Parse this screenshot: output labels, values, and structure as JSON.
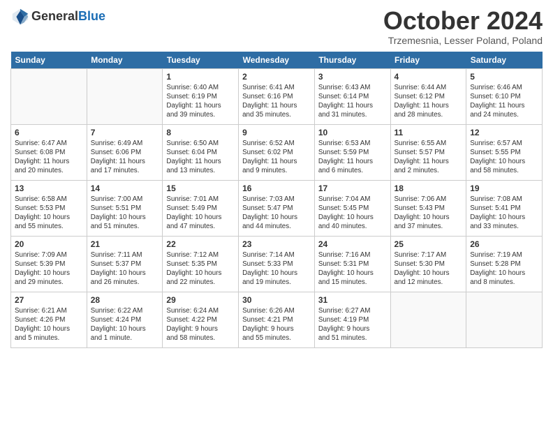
{
  "header": {
    "logo_general": "General",
    "logo_blue": "Blue",
    "month_title": "October 2024",
    "location": "Trzemesnia, Lesser Poland, Poland"
  },
  "weekdays": [
    "Sunday",
    "Monday",
    "Tuesday",
    "Wednesday",
    "Thursday",
    "Friday",
    "Saturday"
  ],
  "weeks": [
    [
      {
        "day": "",
        "detail": ""
      },
      {
        "day": "",
        "detail": ""
      },
      {
        "day": "1",
        "detail": "Sunrise: 6:40 AM\nSunset: 6:19 PM\nDaylight: 11 hours\nand 39 minutes."
      },
      {
        "day": "2",
        "detail": "Sunrise: 6:41 AM\nSunset: 6:16 PM\nDaylight: 11 hours\nand 35 minutes."
      },
      {
        "day": "3",
        "detail": "Sunrise: 6:43 AM\nSunset: 6:14 PM\nDaylight: 11 hours\nand 31 minutes."
      },
      {
        "day": "4",
        "detail": "Sunrise: 6:44 AM\nSunset: 6:12 PM\nDaylight: 11 hours\nand 28 minutes."
      },
      {
        "day": "5",
        "detail": "Sunrise: 6:46 AM\nSunset: 6:10 PM\nDaylight: 11 hours\nand 24 minutes."
      }
    ],
    [
      {
        "day": "6",
        "detail": "Sunrise: 6:47 AM\nSunset: 6:08 PM\nDaylight: 11 hours\nand 20 minutes."
      },
      {
        "day": "7",
        "detail": "Sunrise: 6:49 AM\nSunset: 6:06 PM\nDaylight: 11 hours\nand 17 minutes."
      },
      {
        "day": "8",
        "detail": "Sunrise: 6:50 AM\nSunset: 6:04 PM\nDaylight: 11 hours\nand 13 minutes."
      },
      {
        "day": "9",
        "detail": "Sunrise: 6:52 AM\nSunset: 6:02 PM\nDaylight: 11 hours\nand 9 minutes."
      },
      {
        "day": "10",
        "detail": "Sunrise: 6:53 AM\nSunset: 5:59 PM\nDaylight: 11 hours\nand 6 minutes."
      },
      {
        "day": "11",
        "detail": "Sunrise: 6:55 AM\nSunset: 5:57 PM\nDaylight: 11 hours\nand 2 minutes."
      },
      {
        "day": "12",
        "detail": "Sunrise: 6:57 AM\nSunset: 5:55 PM\nDaylight: 10 hours\nand 58 minutes."
      }
    ],
    [
      {
        "day": "13",
        "detail": "Sunrise: 6:58 AM\nSunset: 5:53 PM\nDaylight: 10 hours\nand 55 minutes."
      },
      {
        "day": "14",
        "detail": "Sunrise: 7:00 AM\nSunset: 5:51 PM\nDaylight: 10 hours\nand 51 minutes."
      },
      {
        "day": "15",
        "detail": "Sunrise: 7:01 AM\nSunset: 5:49 PM\nDaylight: 10 hours\nand 47 minutes."
      },
      {
        "day": "16",
        "detail": "Sunrise: 7:03 AM\nSunset: 5:47 PM\nDaylight: 10 hours\nand 44 minutes."
      },
      {
        "day": "17",
        "detail": "Sunrise: 7:04 AM\nSunset: 5:45 PM\nDaylight: 10 hours\nand 40 minutes."
      },
      {
        "day": "18",
        "detail": "Sunrise: 7:06 AM\nSunset: 5:43 PM\nDaylight: 10 hours\nand 37 minutes."
      },
      {
        "day": "19",
        "detail": "Sunrise: 7:08 AM\nSunset: 5:41 PM\nDaylight: 10 hours\nand 33 minutes."
      }
    ],
    [
      {
        "day": "20",
        "detail": "Sunrise: 7:09 AM\nSunset: 5:39 PM\nDaylight: 10 hours\nand 29 minutes."
      },
      {
        "day": "21",
        "detail": "Sunrise: 7:11 AM\nSunset: 5:37 PM\nDaylight: 10 hours\nand 26 minutes."
      },
      {
        "day": "22",
        "detail": "Sunrise: 7:12 AM\nSunset: 5:35 PM\nDaylight: 10 hours\nand 22 minutes."
      },
      {
        "day": "23",
        "detail": "Sunrise: 7:14 AM\nSunset: 5:33 PM\nDaylight: 10 hours\nand 19 minutes."
      },
      {
        "day": "24",
        "detail": "Sunrise: 7:16 AM\nSunset: 5:31 PM\nDaylight: 10 hours\nand 15 minutes."
      },
      {
        "day": "25",
        "detail": "Sunrise: 7:17 AM\nSunset: 5:30 PM\nDaylight: 10 hours\nand 12 minutes."
      },
      {
        "day": "26",
        "detail": "Sunrise: 7:19 AM\nSunset: 5:28 PM\nDaylight: 10 hours\nand 8 minutes."
      }
    ],
    [
      {
        "day": "27",
        "detail": "Sunrise: 6:21 AM\nSunset: 4:26 PM\nDaylight: 10 hours\nand 5 minutes."
      },
      {
        "day": "28",
        "detail": "Sunrise: 6:22 AM\nSunset: 4:24 PM\nDaylight: 10 hours\nand 1 minute."
      },
      {
        "day": "29",
        "detail": "Sunrise: 6:24 AM\nSunset: 4:22 PM\nDaylight: 9 hours\nand 58 minutes."
      },
      {
        "day": "30",
        "detail": "Sunrise: 6:26 AM\nSunset: 4:21 PM\nDaylight: 9 hours\nand 55 minutes."
      },
      {
        "day": "31",
        "detail": "Sunrise: 6:27 AM\nSunset: 4:19 PM\nDaylight: 9 hours\nand 51 minutes."
      },
      {
        "day": "",
        "detail": ""
      },
      {
        "day": "",
        "detail": ""
      }
    ]
  ]
}
